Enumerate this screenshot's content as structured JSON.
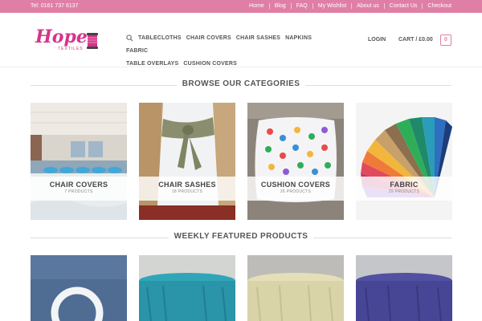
{
  "topbar": {
    "tel": "Tel: 0161 737 6137",
    "links": [
      "Home",
      "Blog",
      "FAQ",
      "My Wishlist",
      "About us",
      "Contact Us",
      "Checkout"
    ]
  },
  "header": {
    "logo_text": "Hope",
    "logo_subtext": "TEXTILES",
    "nav": [
      "TABLECLOTHS",
      "CHAIR COVERS",
      "CHAIR SASHES",
      "NAPKINS",
      "FABRIC",
      "TABLE OVERLAYS",
      "CUSHION COVERS"
    ],
    "login": "LOGIN",
    "cart": "CART / £0.00",
    "cart_count": "0"
  },
  "categories_heading": "BROWSE OUR CATEGORIES",
  "categories": [
    {
      "name": "CHAIR COVERS",
      "count": "7 PRODUCTS"
    },
    {
      "name": "CHAIR SASHES",
      "count": "18 PRODUCTS"
    },
    {
      "name": "CUSHION COVERS",
      "count": "26 PRODUCTS"
    },
    {
      "name": "FABRIC",
      "count": "29 PRODUCTS"
    }
  ],
  "featured_heading": "WEEKLY FEATURED PRODUCTS",
  "colors": {
    "brand_pink": "#e07fa6"
  }
}
